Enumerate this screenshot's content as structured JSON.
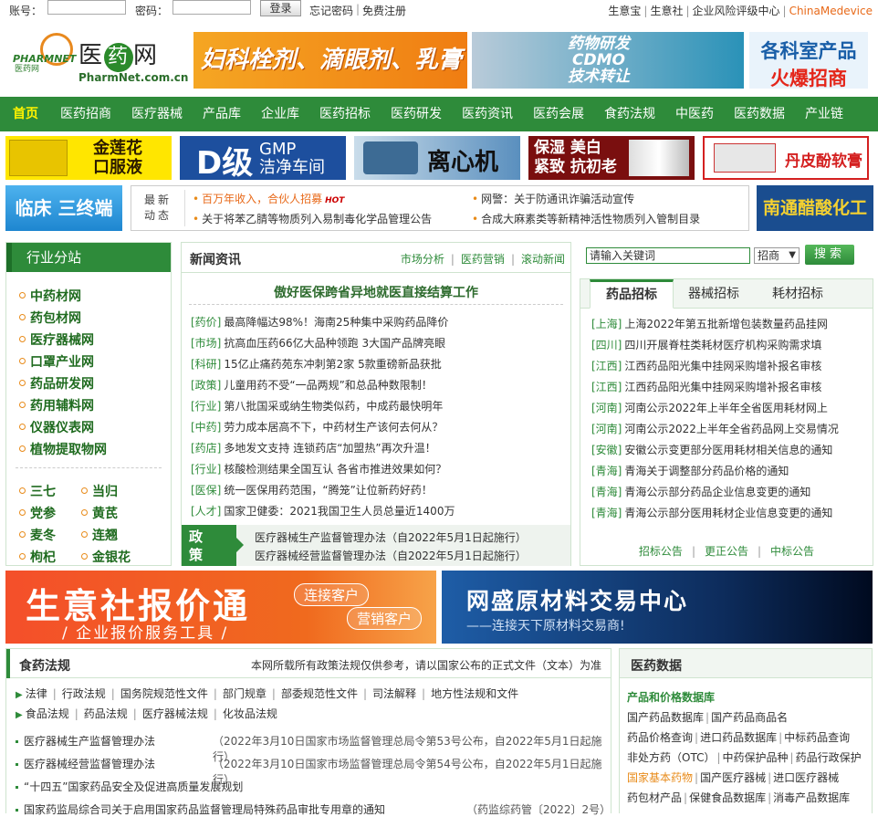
{
  "topbar": {
    "account_label": "账号：",
    "password_label": "密码：",
    "login_button": "登录",
    "forgot_password": "忘记密码",
    "register": "免费注册",
    "links": [
      "生意宝",
      "生意社",
      "企业风险评级中心",
      "ChinaMedevice"
    ]
  },
  "header": {
    "logo_en": "PHARMNET",
    "logo_sub": "医药网",
    "logo_cn_1": "医",
    "logo_cn_2": "药",
    "logo_cn_3": "网",
    "logo_url": "PharmNet.com.cn",
    "banner1": "妇科栓剂、滴眼剂、乳膏剂",
    "banner2_lines": [
      "药物研发",
      "CDMO",
      "技术转让"
    ],
    "banner3_l1": "各科室产品",
    "banner3_l2": "火爆招商"
  },
  "nav": [
    "首页",
    "医药招商",
    "医疗器械",
    "产品库",
    "企业库",
    "医药招标",
    "医药研发",
    "医药资讯",
    "医药会展",
    "食药法规",
    "中医药",
    "医药数据",
    "产业链"
  ],
  "ads": {
    "ad1": [
      "金莲花",
      "口服液"
    ],
    "ad2_d": "D级",
    "ad2": [
      "GMP",
      "洁净车间"
    ],
    "ad3": "离心机",
    "ad4": [
      "保湿 美白",
      "紧致 抗初老"
    ],
    "ad5": "丹皮酚软膏"
  },
  "linchuang": "临床 三终端",
  "ticker": {
    "label": "最新动态",
    "items": [
      "百万年收入，合伙人招募",
      "网警：关于防通讯诈骗活动宣传",
      "关于将苯乙腈等物质列入易制毒化学品管理公告",
      "合成大麻素类等新精神活性物质列入管制目录"
    ],
    "hot": "HOT"
  },
  "nantong": "南通醋酸化工",
  "sidebar": {
    "title": "行业分站",
    "items": [
      "中药材网",
      "药包材网",
      "医疗器械网",
      "口罩产业网",
      "药品研发网",
      "药用辅料网",
      "仪器仪表网",
      "植物提取物网"
    ],
    "herbs": [
      "三七",
      "当归",
      "党参",
      "黄芪",
      "麦冬",
      "连翘",
      "枸杞",
      "金银花"
    ]
  },
  "news": {
    "title": "新闻资讯",
    "links": [
      "市场分析",
      "医药营销",
      "滚动新闻"
    ],
    "headline": "傲好医保跨省异地就医直接结算工作",
    "rows": [
      {
        "cat": "[药价]",
        "text": "最高降幅达98%！海南25种集中采购药品降价"
      },
      {
        "cat": "[市场]",
        "text": "抗高血压药66亿大品种领跑 3大国产品牌亮眼"
      },
      {
        "cat": "[科研]",
        "text": "15亿止痛药苑东冲刺第2家 5款重磅新品获批"
      },
      {
        "cat": "[政策]",
        "text": "儿童用药不受“一品两规”和总品种数限制！"
      },
      {
        "cat": "[行业]",
        "text": "第八批国采或纳生物类似药，中成药最快明年"
      },
      {
        "cat": "[中药]",
        "text": "劳力成本居高不下，中药材生产该何去何从？"
      },
      {
        "cat": "[药店]",
        "text": "多地发文支持 连锁药店“加盟热”再次升温！"
      },
      {
        "cat": "[行业]",
        "text": "核酸检测结果全国互认 各省市推进效果如何？"
      },
      {
        "cat": "[医保]",
        "text": "统一医保用药范围，“腾笼”让位新药好药！"
      },
      {
        "cat": "[人才]",
        "text": "国家卫健委：2021我国卫生人员总量近1400万"
      }
    ],
    "policy_tag": "政策法规",
    "policy": [
      "医疗器械生产监督管理办法（自2022年5月1日起施行）",
      "医疗器械经营监督管理办法（自2022年5月1日起施行）"
    ]
  },
  "search": {
    "placeholder": "请输入关键词",
    "select_value": "招商",
    "button": "搜索"
  },
  "bid": {
    "tabs": [
      "药品招标",
      "器械招标",
      "耗材招标"
    ],
    "rows": [
      {
        "reg": "[上海]",
        "text": "上海2022年第五批新增包装数量药品挂网"
      },
      {
        "reg": "[四川]",
        "text": "四川开展脊柱类耗材医疗机构采购需求填"
      },
      {
        "reg": "[江西]",
        "text": "江西药品阳光集中挂网采购增补报名审核"
      },
      {
        "reg": "[江西]",
        "text": "江西药品阳光集中挂网采购增补报名审核"
      },
      {
        "reg": "[河南]",
        "text": "河南公示2022年上半年全省医用耗材网上"
      },
      {
        "reg": "[河南]",
        "text": "河南公示2022上半年全省药品网上交易情况"
      },
      {
        "reg": "[安徽]",
        "text": "安徽公示变更部分医用耗材相关信息的通知"
      },
      {
        "reg": "[青海]",
        "text": "青海关于调整部分药品价格的通知"
      },
      {
        "reg": "[青海]",
        "text": "青海公示部分药品企业信息变更的通知"
      },
      {
        "reg": "[青海]",
        "text": "青海公示部分医用耗材企业信息变更的通知"
      }
    ],
    "footer": [
      "招标公告",
      "更正公告",
      "中标公告"
    ]
  },
  "wide1": {
    "title": "生意社报价通",
    "sub": "/ 企业报价服务工具 /",
    "pill1": "连接客户",
    "pill2": "营销客户"
  },
  "wide2": {
    "title": "网盛原材料交易中心",
    "sub": "——连接天下原材料交易商!"
  },
  "law": {
    "title": "食药法规",
    "note": "本网所载所有政策法规仅供参考，请以国家公布的正式文件（文本）为准",
    "cats1": [
      "法律",
      "行政法规",
      "国务院规范性文件",
      "部门规章",
      "部委规范性文件",
      "司法解释",
      "地方性法规和文件"
    ],
    "cats2": [
      "食品法规",
      "药品法规",
      "医疗器械法规",
      "化妆品法规"
    ],
    "rows": [
      {
        "text": "医疗器械生产监督管理办法",
        "src": "（2022年3月10日国家市场监督管理总局令第53号公布，自2022年5月1日起施行）"
      },
      {
        "text": "医疗器械经营监督管理办法",
        "src": "（2022年3月10日国家市场监督管理总局令第54号公布，自2022年5月1日起施行）"
      },
      {
        "text": "“十四五”国家药品安全及促进高质量发展规划",
        "src": ""
      },
      {
        "text": "国家药监局综合司关于启用国家药品监督管理局特殊药品审批专用章的通知",
        "src": "（药监综药管〔2022〕2号）"
      }
    ]
  },
  "meddata": {
    "title": "医药数据",
    "subtitle": "产品和价格数据库",
    "rows": [
      [
        "国产药品数据库",
        "国产药品商品名"
      ],
      [
        "药品价格查询",
        "进口药品数据库",
        "中标药品查询"
      ],
      [
        "非处方药（OTC）",
        "中药保护品种",
        "药品行政保护"
      ],
      [
        "国家基本药物",
        "国产医疗器械",
        "进口医疗器械"
      ],
      [
        "药包材产品",
        "保健食品数据库",
        "消毒产品数据库"
      ]
    ]
  },
  "colors": {
    "brand_green": "#2e8b3a",
    "accent_orange": "#e88b1a"
  }
}
